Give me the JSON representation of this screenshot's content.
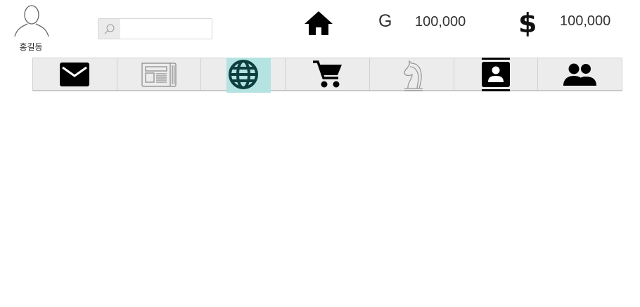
{
  "user": {
    "name": "홍길동",
    "avatar_icon": "user-outline-icon"
  },
  "search": {
    "placeholder": "",
    "value": "",
    "icon": "search-icon"
  },
  "header": {
    "home_icon": "home-icon",
    "gold": {
      "symbol": "G",
      "value": "100,000"
    },
    "dollar": {
      "symbol": "$",
      "value": "100,000"
    }
  },
  "nav": {
    "active_index": 2,
    "items": [
      {
        "icon": "mail-icon"
      },
      {
        "icon": "newspaper-icon"
      },
      {
        "icon": "globe-icon"
      },
      {
        "icon": "cart-icon"
      },
      {
        "icon": "chess-knight-icon"
      },
      {
        "icon": "contact-card-icon"
      },
      {
        "icon": "people-icon"
      }
    ]
  },
  "colors": {
    "active_highlight": "#b4e3e1",
    "nav_bg": "#ececec",
    "active_icon": "#0d3f40"
  }
}
